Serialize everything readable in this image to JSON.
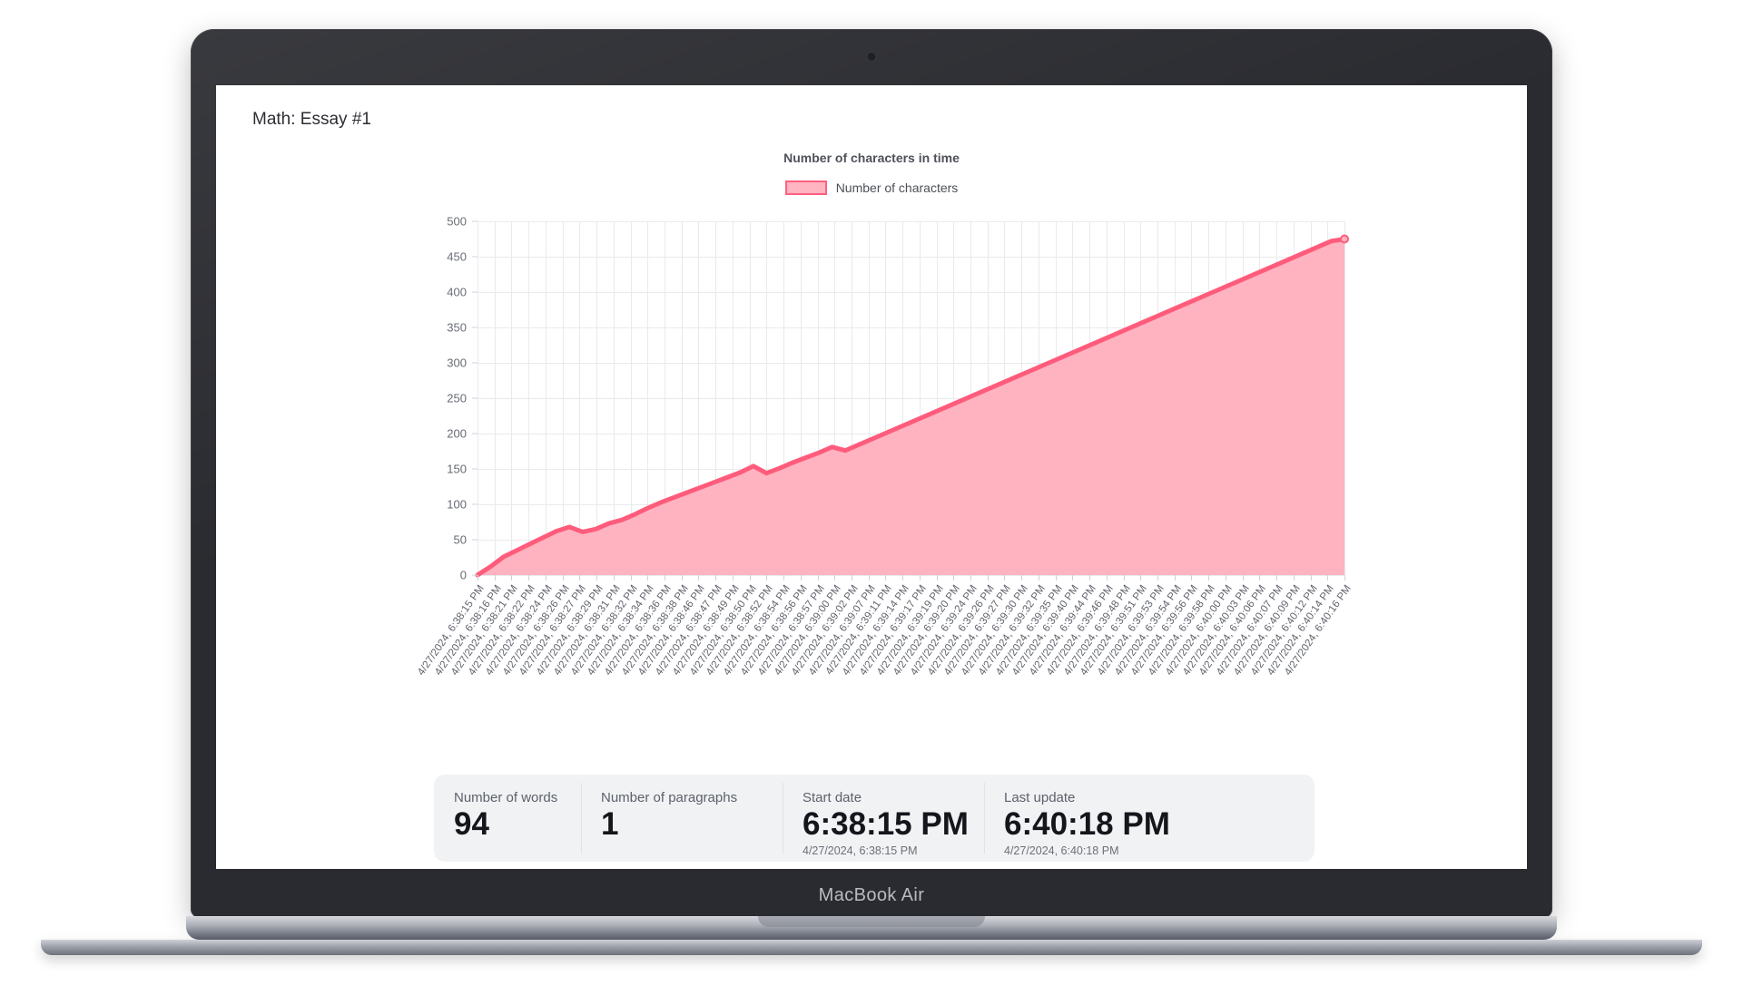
{
  "device": {
    "name": "MacBook Air",
    "camera_icon": "camera-dot-icon"
  },
  "app": {
    "page_title": "Math: Essay #1"
  },
  "chart_data": {
    "type": "area",
    "title": "Number of characters in time",
    "xlabel": "",
    "ylabel": "",
    "ylim": [
      0,
      500
    ],
    "ytick_step": 50,
    "grid": true,
    "legend_position": "top-center",
    "legend": [
      "Number of characters"
    ],
    "colors": {
      "line": "#FF5C7C",
      "fill": "#FFB3C1",
      "grid": "#e8eaee",
      "axis_text": "#666a72"
    },
    "yticks": [
      0,
      50,
      100,
      150,
      200,
      250,
      300,
      350,
      400,
      450,
      500
    ],
    "series": [
      {
        "name": "Number of characters",
        "values": [
          0,
          12,
          26,
          35,
          44,
          53,
          62,
          68,
          61,
          65,
          73,
          78,
          86,
          95,
          103,
          110,
          117,
          124,
          131,
          138,
          145,
          154,
          144,
          151,
          159,
          166,
          173,
          181,
          176,
          184,
          192,
          200,
          208,
          216,
          224,
          232,
          240,
          248,
          256,
          264,
          272,
          280,
          288,
          296,
          304,
          312,
          320,
          328,
          336,
          344,
          352,
          360,
          368,
          376,
          384,
          392,
          400,
          408,
          416,
          424,
          432,
          440,
          448,
          456,
          464,
          472,
          475
        ]
      }
    ],
    "categories": [
      "4/27/2024, 6:38:15 PM",
      "4/27/2024, 6:38:16 PM",
      "4/27/2024, 6:38:21 PM",
      "4/27/2024, 6:38:22 PM",
      "4/27/2024, 6:38:24 PM",
      "4/27/2024, 6:38:26 PM",
      "4/27/2024, 6:38:27 PM",
      "4/27/2024, 6:38:29 PM",
      "4/27/2024, 6:38:31 PM",
      "4/27/2024, 6:38:32 PM",
      "4/27/2024, 6:38:34 PM",
      "4/27/2024, 6:38:36 PM",
      "4/27/2024, 6:38:38 PM",
      "4/27/2024, 6:38:46 PM",
      "4/27/2024, 6:38:47 PM",
      "4/27/2024, 6:38:49 PM",
      "4/27/2024, 6:38:50 PM",
      "4/27/2024, 6:38:52 PM",
      "4/27/2024, 6:38:54 PM",
      "4/27/2024, 6:38:56 PM",
      "4/27/2024, 6:38:57 PM",
      "4/27/2024, 6:39:00 PM",
      "4/27/2024, 6:39:02 PM",
      "4/27/2024, 6:39:07 PM",
      "4/27/2024, 6:39:11 PM",
      "4/27/2024, 6:39:14 PM",
      "4/27/2024, 6:39:17 PM",
      "4/27/2024, 6:39:19 PM",
      "4/27/2024, 6:39:20 PM",
      "4/27/2024, 6:39:24 PM",
      "4/27/2024, 6:39:26 PM",
      "4/27/2024, 6:39:27 PM",
      "4/27/2024, 6:39:30 PM",
      "4/27/2024, 6:39:32 PM",
      "4/27/2024, 6:39:35 PM",
      "4/27/2024, 6:39:40 PM",
      "4/27/2024, 6:39:44 PM",
      "4/27/2024, 6:39:46 PM",
      "4/27/2024, 6:39:48 PM",
      "4/27/2024, 6:39:51 PM",
      "4/27/2024, 6:39:53 PM",
      "4/27/2024, 6:39:54 PM",
      "4/27/2024, 6:39:56 PM",
      "4/27/2024, 6:39:58 PM",
      "4/27/2024, 6:40:00 PM",
      "4/27/2024, 6:40:03 PM",
      "4/27/2024, 6:40:06 PM",
      "4/27/2024, 6:40:07 PM",
      "4/27/2024, 6:40:09 PM",
      "4/27/2024, 6:40:12 PM",
      "4/27/2024, 6:40:14 PM",
      "4/27/2024, 6:40:16 PM"
    ]
  },
  "stats": [
    {
      "label": "Number of words",
      "value": "94",
      "sub": ""
    },
    {
      "label": "Number of paragraphs",
      "value": "1",
      "sub": ""
    },
    {
      "label": "Start date",
      "value": "6:38:15 PM",
      "sub": "4/27/2024, 6:38:15 PM"
    },
    {
      "label": "Last update",
      "value": "6:40:18 PM",
      "sub": "4/27/2024, 6:40:18 PM"
    }
  ]
}
